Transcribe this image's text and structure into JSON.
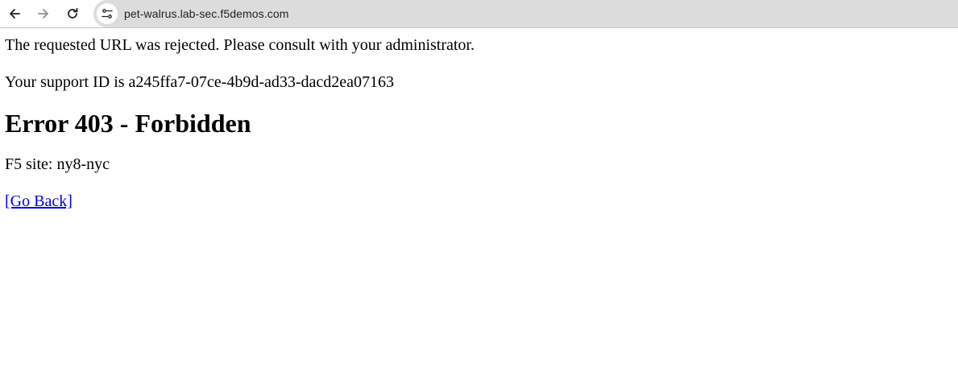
{
  "browser": {
    "url": "pet-walrus.lab-sec.f5demos.com",
    "icons": {
      "back": "arrow-left-icon",
      "forward": "arrow-right-icon",
      "reload": "reload-icon",
      "site_info": "tune-icon"
    },
    "colors": {
      "omnibox_bg": "#dcdcdc",
      "forward_disabled": "#8e8e8e"
    }
  },
  "page": {
    "message": "The requested URL was rejected. Please consult with your administrator.",
    "support_id": "Your support ID is a245ffa7-07ce-4b9d-ad33-dacd2ea07163",
    "heading": "Error 403 - Forbidden",
    "site": "F5 site: ny8-nyc",
    "go_back": "[Go Back]",
    "link_color": "#0000ee"
  }
}
